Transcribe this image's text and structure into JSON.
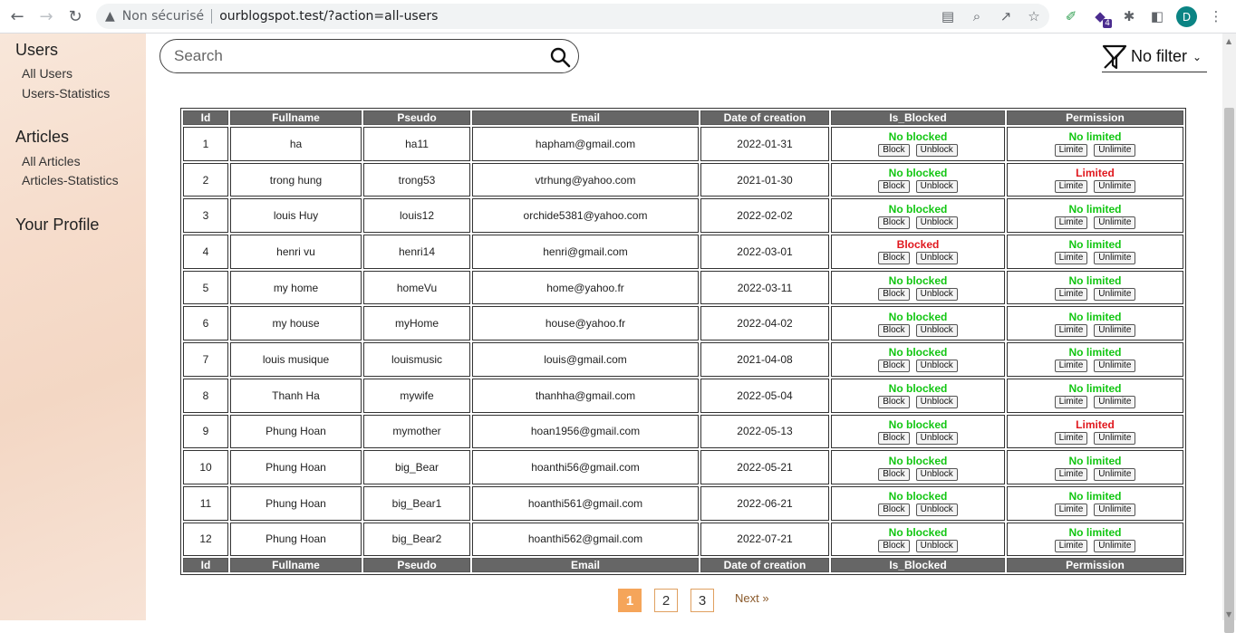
{
  "browser": {
    "security_label": "Non sécurisé",
    "url": "ourblogspot.test/?action=all-users",
    "profile_initial": "D",
    "extension_badge": "4"
  },
  "sidebar": {
    "groups": [
      {
        "title": "Users",
        "items": [
          "All Users",
          "Users-Statistics"
        ]
      },
      {
        "title": "Articles",
        "items": [
          "All Articles",
          "Articles-Statistics"
        ]
      },
      {
        "title": "Your Profile",
        "items": []
      }
    ]
  },
  "search": {
    "placeholder": "Search"
  },
  "filter": {
    "label": "No filter"
  },
  "table": {
    "headers": [
      "Id",
      "Fullname",
      "Pseudo",
      "Email",
      "Date of creation",
      "Is_Blocked",
      "Permission"
    ],
    "block_label": "Block",
    "unblock_label": "Unblock",
    "limite_label": "Limite",
    "unlimite_label": "Unlimite",
    "rows": [
      {
        "id": "1",
        "fullname": "ha",
        "pseudo": "ha11",
        "email": "hapham@gmail.com",
        "date": "2022-01-31",
        "blocked": "No blocked",
        "permission": "No limited"
      },
      {
        "id": "2",
        "fullname": "trong hung",
        "pseudo": "trong53",
        "email": "vtrhung@yahoo.com",
        "date": "2021-01-30",
        "blocked": "No blocked",
        "permission": "Limited"
      },
      {
        "id": "3",
        "fullname": "louis Huy",
        "pseudo": "louis12",
        "email": "orchide5381@yahoo.com",
        "date": "2022-02-02",
        "blocked": "No blocked",
        "permission": "No limited"
      },
      {
        "id": "4",
        "fullname": "henri vu",
        "pseudo": "henri14",
        "email": "henri@gmail.com",
        "date": "2022-03-01",
        "blocked": "Blocked",
        "permission": "No limited"
      },
      {
        "id": "5",
        "fullname": "my home",
        "pseudo": "homeVu",
        "email": "home@yahoo.fr",
        "date": "2022-03-11",
        "blocked": "No blocked",
        "permission": "No limited"
      },
      {
        "id": "6",
        "fullname": "my house",
        "pseudo": "myHome",
        "email": "house@yahoo.fr",
        "date": "2022-04-02",
        "blocked": "No blocked",
        "permission": "No limited"
      },
      {
        "id": "7",
        "fullname": "louis musique",
        "pseudo": "louismusic",
        "email": "louis@gmail.com",
        "date": "2021-04-08",
        "blocked": "No blocked",
        "permission": "No limited"
      },
      {
        "id": "8",
        "fullname": "Thanh Ha",
        "pseudo": "mywife",
        "email": "thanhha@gmail.com",
        "date": "2022-05-04",
        "blocked": "No blocked",
        "permission": "No limited"
      },
      {
        "id": "9",
        "fullname": "Phung Hoan",
        "pseudo": "mymother",
        "email": "hoan1956@gmail.com",
        "date": "2022-05-13",
        "blocked": "No blocked",
        "permission": "Limited"
      },
      {
        "id": "10",
        "fullname": "Phung Hoan",
        "pseudo": "big_Bear",
        "email": "hoanthi56@gmail.com",
        "date": "2022-05-21",
        "blocked": "No blocked",
        "permission": "No limited"
      },
      {
        "id": "11",
        "fullname": "Phung Hoan",
        "pseudo": "big_Bear1",
        "email": "hoanthi561@gmail.com",
        "date": "2022-06-21",
        "blocked": "No blocked",
        "permission": "No limited"
      },
      {
        "id": "12",
        "fullname": "Phung Hoan",
        "pseudo": "big_Bear2",
        "email": "hoanthi562@gmail.com",
        "date": "2022-07-21",
        "blocked": "No blocked",
        "permission": "No limited"
      }
    ]
  },
  "pagination": {
    "pages": [
      "1",
      "2",
      "3"
    ],
    "active": "1",
    "next_label": "Next »"
  },
  "colors": {
    "ok": "#12c612",
    "bad": "#e0181e",
    "header": "#666666",
    "page_active": "#f5a55a"
  }
}
